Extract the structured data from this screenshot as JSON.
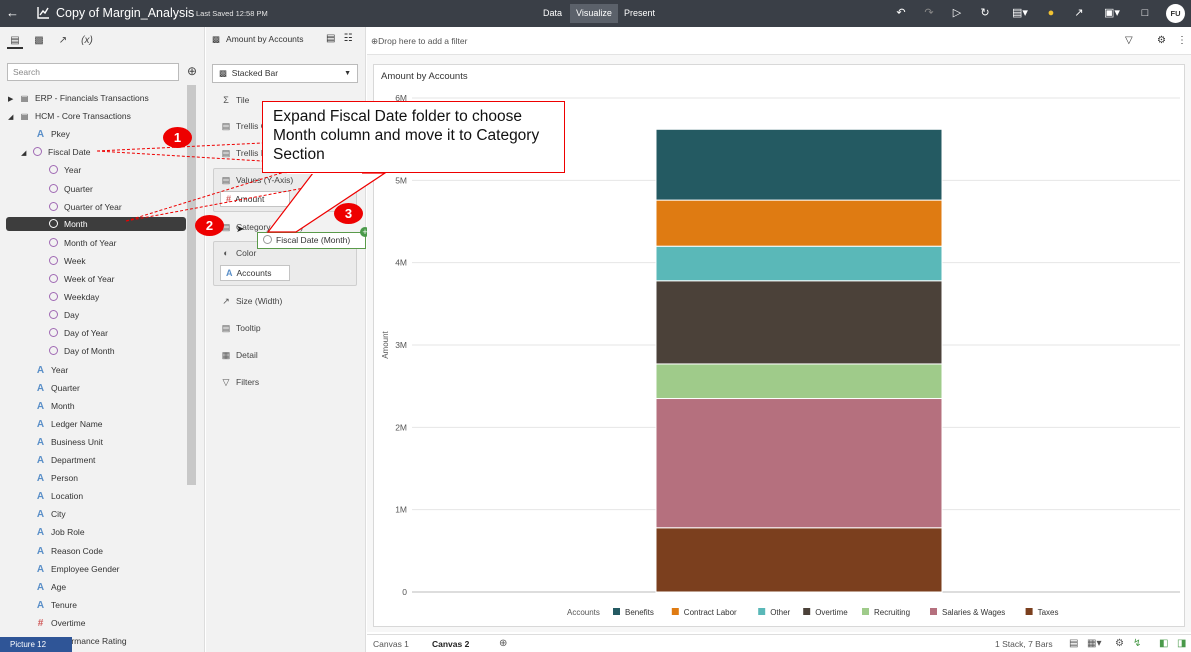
{
  "topbar": {
    "title": "Copy of Margin_Analysis",
    "saved": "Last Saved 12:58 PM",
    "modes": [
      "Data",
      "Visualize",
      "Present"
    ],
    "active_mode": "Visualize",
    "avatar": "FU",
    "bg_color": "#3a3f47"
  },
  "data_panel": {
    "search_placeholder": "Search",
    "tree": [
      {
        "label": "ERP - Financials Transactions",
        "type": "subject-area",
        "expanded": false
      },
      {
        "label": "HCM - Core Transactions",
        "type": "subject-area",
        "expanded": true
      },
      {
        "label": "Pkey",
        "type": "attribute"
      },
      {
        "label": "Fiscal Date",
        "type": "time-folder",
        "expanded": true
      },
      {
        "label": "Year",
        "type": "time"
      },
      {
        "label": "Quarter",
        "type": "time"
      },
      {
        "label": "Quarter of Year",
        "type": "time"
      },
      {
        "label": "Month",
        "type": "time",
        "selected": true
      },
      {
        "label": "Month of Year",
        "type": "time"
      },
      {
        "label": "Week",
        "type": "time"
      },
      {
        "label": "Week of Year",
        "type": "time"
      },
      {
        "label": "Weekday",
        "type": "time"
      },
      {
        "label": "Day",
        "type": "time"
      },
      {
        "label": "Day of Year",
        "type": "time"
      },
      {
        "label": "Day of Month",
        "type": "time"
      },
      {
        "label": "Year",
        "type": "attribute"
      },
      {
        "label": "Quarter",
        "type": "attribute"
      },
      {
        "label": "Month",
        "type": "attribute"
      },
      {
        "label": "Ledger Name",
        "type": "attribute"
      },
      {
        "label": "Business Unit",
        "type": "attribute"
      },
      {
        "label": "Department",
        "type": "attribute"
      },
      {
        "label": "Person",
        "type": "attribute"
      },
      {
        "label": "Location",
        "type": "attribute"
      },
      {
        "label": "City",
        "type": "attribute"
      },
      {
        "label": "Job Role",
        "type": "attribute"
      },
      {
        "label": "Reason Code",
        "type": "attribute"
      },
      {
        "label": "Employee Gender",
        "type": "attribute"
      },
      {
        "label": "Age",
        "type": "attribute"
      },
      {
        "label": "Tenure",
        "type": "attribute"
      },
      {
        "label": "Overtime",
        "type": "measure"
      },
      {
        "label": "Performance Rating",
        "type": "measure"
      }
    ]
  },
  "grammar_panel": {
    "viz_name": "Amount by Accounts",
    "chart_type": "Stacked Bar",
    "tile": "Tile",
    "trellis_columns": "Trellis C",
    "trellis_rows": "Trellis I",
    "values_label": "Values (Y-Axis)",
    "values_pill": "Amount",
    "category_label": "Category (X-Axis)",
    "color_label": "Color",
    "color_pill": "Accounts",
    "size_label": "Size (Width)",
    "tooltip_label": "Tooltip",
    "detail_label": "Detail",
    "filters_label": "Filters",
    "drag_pill": "Fiscal Date (Month)"
  },
  "filter_bar": {
    "placeholder": "Drop here to add a filter"
  },
  "annotation": {
    "text": "Expand Fiscal Date folder to choose Month column and move it to Category Section",
    "steps": [
      "1",
      "2",
      "3"
    ],
    "color": "#e00000"
  },
  "chart_data": {
    "type": "bar",
    "stacked": true,
    "title": "Amount by Accounts",
    "ylabel": "Amount",
    "ylim": [
      0,
      6000000
    ],
    "y_ticks": [
      "0",
      "1M",
      "2M",
      "3M",
      "4M",
      "5M",
      "6M"
    ],
    "y_tick_values": [
      0,
      1000000,
      2000000,
      3000000,
      4000000,
      5000000,
      6000000
    ],
    "legend_title": "Accounts",
    "legend_position": "bottom",
    "grid": true,
    "series": [
      {
        "name": "Taxes",
        "value": 780000,
        "color": "#7b3f1e"
      },
      {
        "name": "Salaries & Wages",
        "value": 1570000,
        "color": "#b5707e"
      },
      {
        "name": "Recruiting",
        "value": 420000,
        "color": "#9fcb8a"
      },
      {
        "name": "Overtime",
        "value": 1010000,
        "color": "#4b4139"
      },
      {
        "name": "Other",
        "value": 420000,
        "color": "#5ab8b8"
      },
      {
        "name": "Contract Labor",
        "value": 560000,
        "color": "#df7b12"
      },
      {
        "name": "Benefits",
        "value": 860000,
        "color": "#245a62"
      }
    ],
    "legend_order": [
      "Benefits",
      "Contract Labor",
      "Other",
      "Overtime",
      "Recruiting",
      "Salaries & Wages",
      "Taxes"
    ]
  },
  "bottom_bar": {
    "tabs": [
      "Canvas 1",
      "Canvas 2"
    ],
    "active_tab": "Canvas 2",
    "status": "1 Stack, 7 Bars",
    "picture_label": "Picture  12"
  }
}
